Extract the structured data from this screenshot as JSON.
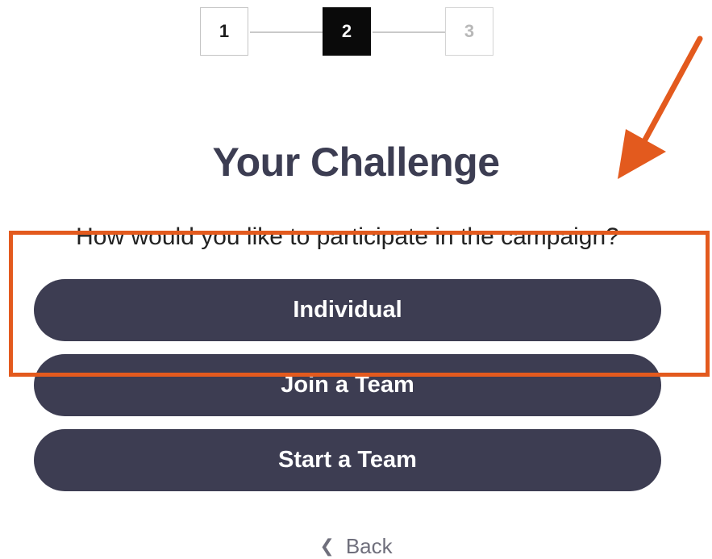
{
  "stepper": {
    "steps": [
      "1",
      "2",
      "3"
    ],
    "active_step": 2
  },
  "page": {
    "title": "Your Challenge",
    "question": "How would you like to participate in the campaign?"
  },
  "options": [
    {
      "label": "Individual"
    },
    {
      "label": "Join a Team"
    },
    {
      "label": "Start a Team"
    }
  ],
  "nav": {
    "back_label": "Back",
    "back_icon": "chevron-left-icon"
  },
  "annotation": {
    "color": "#e35a1e"
  },
  "colors": {
    "button_bg": "#3d3d52",
    "title": "#3c3d52",
    "active_step_bg": "#0a0a0a"
  }
}
